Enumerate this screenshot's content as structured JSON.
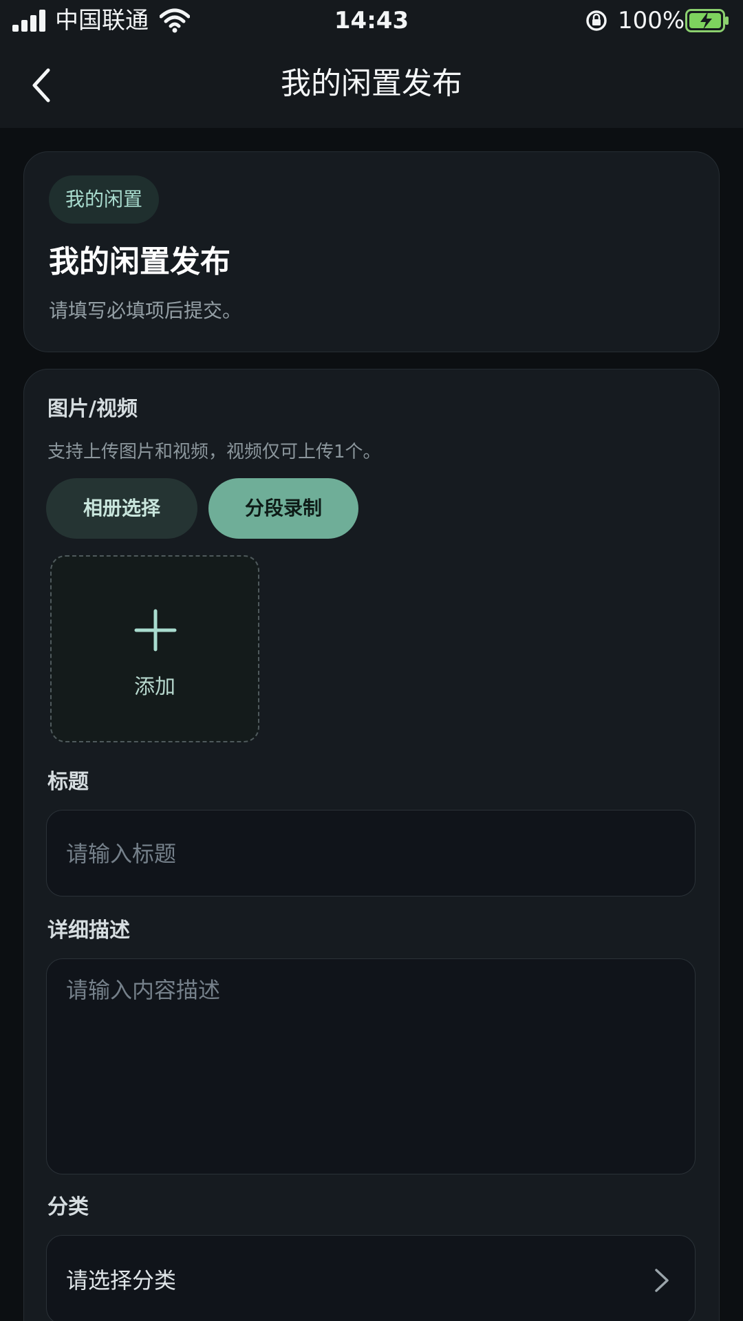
{
  "status_bar": {
    "carrier": "中国联通",
    "time": "14:43",
    "battery_percent": "100%",
    "signal_bars": 4,
    "battery_level": 1.0,
    "charging": true
  },
  "nav": {
    "title": "我的闲置发布",
    "back_icon": "chevron-left-icon"
  },
  "intro": {
    "badge": "我的闲置",
    "title": "我的闲置发布",
    "subtitle": "请填写必填项后提交。"
  },
  "media": {
    "label": "图片/视频",
    "hint": "支持上传图片和视频，视频仅可上传1个。",
    "album_button": "相册选择",
    "record_button": "分段录制",
    "add_label": "添加",
    "add_icon": "plus-icon"
  },
  "title_field": {
    "label": "标题",
    "placeholder": "请输入标题"
  },
  "description_field": {
    "label": "详细描述",
    "placeholder": "请输入内容描述"
  },
  "category_field": {
    "label": "分类",
    "value": "请选择分类",
    "icon": "chevron-right-icon"
  },
  "colors": {
    "background": "#0c0f12",
    "card": "#161b20",
    "accent": "#6fae98",
    "accent_text": "#a9dccf"
  }
}
